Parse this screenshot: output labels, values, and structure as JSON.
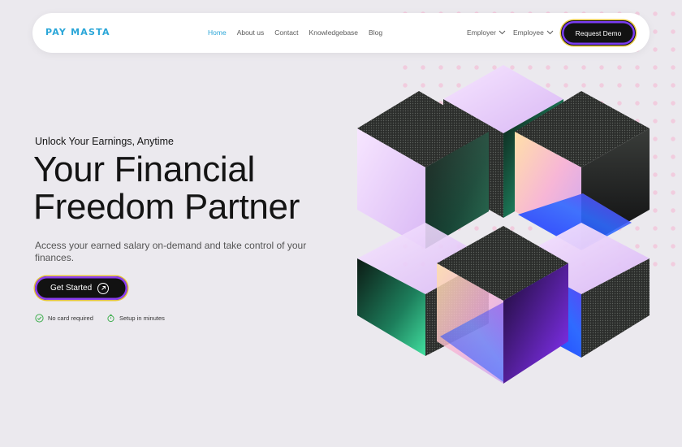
{
  "nav": {
    "logo": "PAY MASTA",
    "links": [
      "Home",
      "About us",
      "Contact",
      "Knowledgebase",
      "Blog"
    ],
    "active": "Home",
    "dropdowns": [
      "Employer",
      "Employee"
    ],
    "cta": "Request Demo"
  },
  "hero": {
    "eyebrow": "Unlock Your Earnings, Anytime",
    "headline_line1": "Your Financial",
    "headline_line2": "Freedom Partner",
    "subtitle": "Access your earned salary on-demand and take control of your finances.",
    "cta": "Get Started",
    "features": [
      "No card required",
      "Setup in minutes"
    ]
  },
  "colors": {
    "accent": "#2aa6d8",
    "check": "#3fae4e",
    "dark": "#121212"
  },
  "icons": {
    "cta_icon": "arrow-up-right-icon",
    "feature_icons": [
      "check-circle-icon",
      "stopwatch-icon"
    ]
  }
}
